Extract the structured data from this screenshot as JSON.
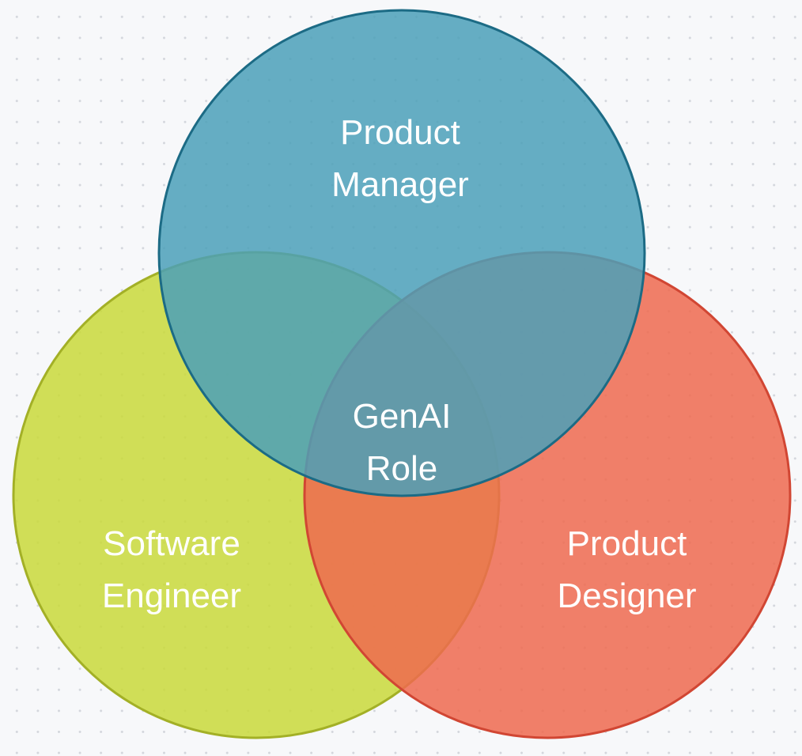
{
  "diagram": {
    "type": "venn",
    "circles": [
      {
        "key": "software_engineer",
        "label_lines": [
          "Software",
          "Engineer"
        ],
        "fill": "#c9d93a",
        "stroke": "#a3b026"
      },
      {
        "key": "product_designer",
        "label_lines": [
          "Product",
          "Designer"
        ],
        "fill": "#ef6a4f",
        "stroke": "#d14633"
      },
      {
        "key": "product_manager",
        "label_lines": [
          "Product",
          "Manager"
        ],
        "fill": "#4ba0b8",
        "stroke": "#1c6b85"
      }
    ],
    "center": {
      "label_lines": [
        "GenAI",
        "Role"
      ]
    }
  }
}
